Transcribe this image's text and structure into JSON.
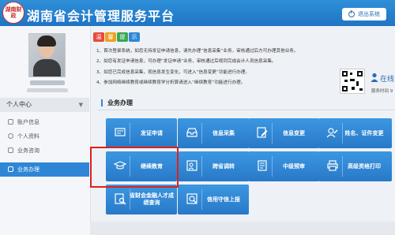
{
  "header": {
    "logo_text": "湖南财政",
    "title": "湖南省会计管理服务平台",
    "logout_label": "退出系统"
  },
  "sidebar": {
    "menu_title": "个人中心",
    "items": [
      {
        "label": "账户信息",
        "icon": "account-icon"
      },
      {
        "label": "个人资料",
        "icon": "person-icon"
      },
      {
        "label": "业务咨询",
        "icon": "chat-icon"
      },
      {
        "label": "业务办理",
        "icon": "task-icon",
        "active": true
      }
    ]
  },
  "notice": {
    "badge": [
      "温",
      "馨",
      "提",
      "示"
    ],
    "lines": [
      "1、首次登录系统，如您无持发证申请信息，请先办理“信息采集”业务，审核通过后方可办理其他业务。",
      "2、如您有发证申请信息，可办理“发证申请”业务，审核通过后视同完成会计人员信息采集。",
      "3、如您已完成信息采集，现信息发生变化，可进入“信息变更”功能进行办理。",
      "4、参加网络继续教育或继续教育学分折算请进入“继续教育”功能进行办理。"
    ]
  },
  "online": {
    "label": "在线",
    "service_time": "服务时间 9"
  },
  "section": {
    "title": "业务办理"
  },
  "tiles": [
    {
      "label": "发证申请",
      "icon": "certificate-icon"
    },
    {
      "label": "信息采集",
      "icon": "inbox-icon"
    },
    {
      "label": "信息变更",
      "icon": "edit-doc-icon"
    },
    {
      "label": "姓名、证件变更",
      "icon": "id-card-icon"
    },
    {
      "label": "继续教育",
      "icon": "graduation-cap-icon"
    },
    {
      "label": "跨省调转",
      "icon": "transfer-icon"
    },
    {
      "label": "中级预审",
      "icon": "review-icon"
    },
    {
      "label": "高级资格打印",
      "icon": "printer-icon"
    },
    {
      "label": "省财会金融人才成绩查询",
      "icon": "score-query-icon"
    },
    {
      "label": "信用守信上报",
      "icon": "credit-report-icon"
    }
  ]
}
